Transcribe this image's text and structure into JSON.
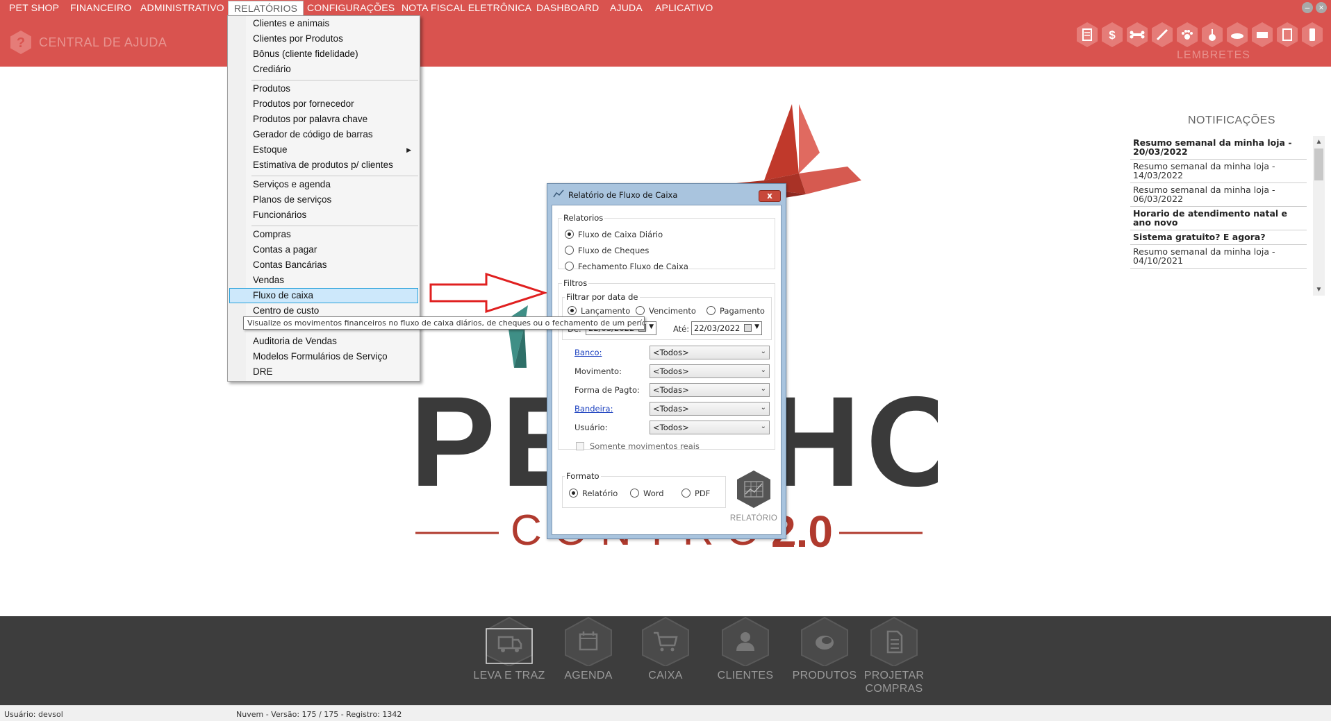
{
  "menubar": {
    "items": [
      "PET SHOP",
      "FINANCEIRO",
      "ADMINISTRATIVO",
      "RELATÓRIOS",
      "CONFIGURAÇÕES",
      "NOTA FISCAL ELETRÔNICA",
      "DASHBOARD",
      "AJUDA",
      "APLICATIVO"
    ],
    "active": "RELATÓRIOS"
  },
  "toolbar": {
    "help_label": "CENTRAL DE AJUDA",
    "lembretes_label": "LEMBRETES",
    "icons": [
      "document-icon",
      "dollar-icon",
      "bone-icon",
      "syringe-icon",
      "paw-icon",
      "grooming-icon",
      "pet-bed-icon",
      "vehicle-icon",
      "note-icon",
      "mobile-icon"
    ]
  },
  "dropdown": {
    "items": [
      "Clientes e animais",
      "Clientes por Produtos",
      "Bônus (cliente fidelidade)",
      "Crediário",
      "Produtos",
      "Produtos por fornecedor",
      "Produtos por palavra chave",
      "Gerador de código de barras",
      "Estoque",
      "Estimativa de produtos p/ clientes",
      "Serviços e agenda",
      "Planos de serviços",
      "Funcionários",
      "Compras",
      "Contas a pagar",
      "Contas Bancárias",
      "Vendas",
      "Fluxo de caixa",
      "Centro de custo",
      "Auditoria de Vendas",
      "Modelos Formulários de Serviço",
      "DRE"
    ],
    "selected": "Fluxo de caixa",
    "submenu_item": "Estoque"
  },
  "tooltip": {
    "text": "Visualize os movimentos financeiros no fluxo de caixa diários, de cheques ou o fechamento de um período."
  },
  "notifications": {
    "title": "NOTIFICAÇÕES",
    "items": [
      {
        "text": "Resumo semanal da minha loja - 20/03/2022",
        "unread": true
      },
      {
        "text": "Resumo semanal da minha loja - 14/03/2022",
        "unread": false
      },
      {
        "text": "Resumo semanal da minha loja - 06/03/2022",
        "unread": false
      },
      {
        "text": "Horario de atendimento natal e ano novo",
        "unread": true
      },
      {
        "text": "Sistema gratuito? E agora?",
        "unread": true
      },
      {
        "text": "Resumo semanal da minha loja - 04/10/2021",
        "unread": false
      }
    ]
  },
  "dialog": {
    "title": "Relatório de Fluxo de Caixa",
    "close_label": "x",
    "relatorios": {
      "title": "Relatorios",
      "options": [
        "Fluxo de Caixa Diário",
        "Fluxo de Cheques",
        "Fechamento Fluxo de Caixa"
      ],
      "selected": "Fluxo de Caixa Diário"
    },
    "filtros": {
      "title": "Filtros",
      "filtrar_title": "Filtrar por data de",
      "date_options": [
        "Lançamento",
        "Vencimento",
        "Pagamento"
      ],
      "date_selected": "Lançamento",
      "de_label": "De:",
      "de_value": "22/03/2022",
      "ate_label": "Até:",
      "ate_value": "22/03/2022",
      "fields": [
        {
          "label": "Banco:",
          "value": "<Todos>",
          "link": true
        },
        {
          "label": "Movimento:",
          "value": "<Todos>",
          "link": false
        },
        {
          "label": "Forma de Pagto:",
          "value": "<Todas>",
          "link": false
        },
        {
          "label": "Bandeira:",
          "value": "<Todas>",
          "link": true
        },
        {
          "label": "Usuário:",
          "value": "<Todos>",
          "link": false
        }
      ],
      "somente_label": "Somente movimentos reais",
      "somente_checked": false
    },
    "formato": {
      "title": "Formato",
      "options": [
        "Relatório",
        "Word",
        "PDF"
      ],
      "selected": "Relatório"
    },
    "report_button_label": "RELATÓRIO"
  },
  "logo": {
    "text_main": "PET SHOP",
    "text_sub": "CONTROL",
    "text_version": "2.0"
  },
  "bottom_shortcuts": [
    {
      "label": "LEVA E TRAZ",
      "icon": "truck-icon"
    },
    {
      "label": "AGENDA",
      "icon": "calendar-icon"
    },
    {
      "label": "CAIXA",
      "icon": "cart-icon"
    },
    {
      "label": "CLIENTES",
      "icon": "user-icon"
    },
    {
      "label": "PRODUTOS",
      "icon": "product-icon"
    },
    {
      "label": "PROJETAR COMPRAS",
      "icon": "document-icon"
    }
  ],
  "statusbar": {
    "user": "Usuário: devsol",
    "version": "Nuvem - Versão: 175 / 175 - Registro: 1342"
  },
  "colors": {
    "brand_red": "#d9534f",
    "dark_panel": "#3d3d3d",
    "selection": "#cde8fb",
    "arrow": "#e02020"
  }
}
